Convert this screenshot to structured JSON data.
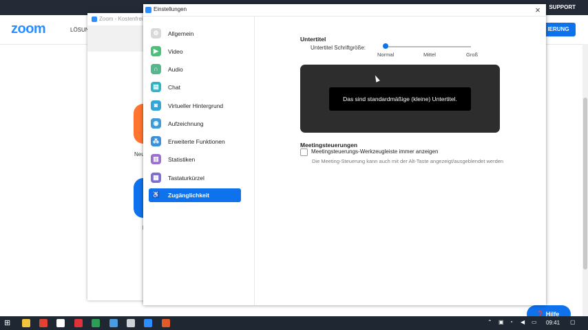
{
  "site": {
    "logo": "zoom",
    "nav_item": "LÖSUN",
    "support": "SUPPORT",
    "cta": "IERUNG",
    "help": "Hilfe"
  },
  "zoom_client": {
    "title": "Zoom - Kostenfrei",
    "tile_label": "Neu",
    "tile_label2": "l"
  },
  "settings": {
    "window_title": "Einstellungen",
    "close_icon": "×",
    "sidebar": [
      {
        "label": "Allgemein",
        "icon": "gear-icon",
        "color": "#d9d9d9",
        "glyph": "⚙"
      },
      {
        "label": "Video",
        "icon": "video-icon",
        "color": "#4cbf7a",
        "glyph": "▶"
      },
      {
        "label": "Audio",
        "icon": "headphones-icon",
        "color": "#55b88c",
        "glyph": "∩"
      },
      {
        "label": "Chat",
        "icon": "chat-icon",
        "color": "#2fb3c6",
        "glyph": "▤"
      },
      {
        "label": "Virtueller Hintergrund",
        "icon": "person-background-icon",
        "color": "#34a6d6",
        "glyph": "◙"
      },
      {
        "label": "Aufzeichnung",
        "icon": "record-icon",
        "color": "#3c9cdb",
        "glyph": "◉"
      },
      {
        "label": "Erweiterte Funktionen",
        "icon": "advanced-features-icon",
        "color": "#3b8fdc",
        "glyph": "⁂"
      },
      {
        "label": "Statistiken",
        "icon": "statistics-icon",
        "color": "#9b6fcf",
        "glyph": "▥"
      },
      {
        "label": "Tastaturkürzel",
        "icon": "keyboard-icon",
        "color": "#7d6fd0",
        "glyph": "▦"
      },
      {
        "label": "Zugänglichkeit",
        "icon": "accessibility-icon",
        "color": "#0e72ed",
        "glyph": "♿"
      }
    ],
    "active_index": 9,
    "subtitles": {
      "heading": "Untertitel",
      "font_size_label": "Untertitel Schriftgröße:",
      "options": [
        "Normal",
        "Mittel",
        "Groß"
      ],
      "selected": "Normal",
      "preview_text": "Das sind standardmäßige (kleine) Untertitel."
    },
    "meeting_controls": {
      "heading": "Meetingsteuerungen",
      "checkbox_label": "Meetingsteuerungs-Werkzeugleiste immer anzeigen",
      "checked": false,
      "hint": "Die Meeting-Steuerung kann auch mit der Alt-Taste angezeigt/ausgeblendet werden"
    }
  },
  "taskbar": {
    "clock": "09:41",
    "apps": [
      {
        "icon": "windows-start-icon",
        "color": "#ffffff"
      },
      {
        "icon": "file-explorer-icon",
        "color": "#f3c33d"
      },
      {
        "icon": "chrome-icon",
        "color": "#e34133"
      },
      {
        "icon": "chat-app-icon",
        "color": "#ffffff"
      },
      {
        "icon": "screen-recorder-icon",
        "color": "#e0323a"
      },
      {
        "icon": "drive-icon",
        "color": "#2c9e55"
      },
      {
        "icon": "notepad-icon",
        "color": "#4b9be0"
      },
      {
        "icon": "calculator-icon",
        "color": "#cfd3d8"
      },
      {
        "icon": "zoom-app-icon",
        "color": "#2d8cff"
      },
      {
        "icon": "presentation-app-icon",
        "color": "#e05a2a"
      }
    ]
  }
}
